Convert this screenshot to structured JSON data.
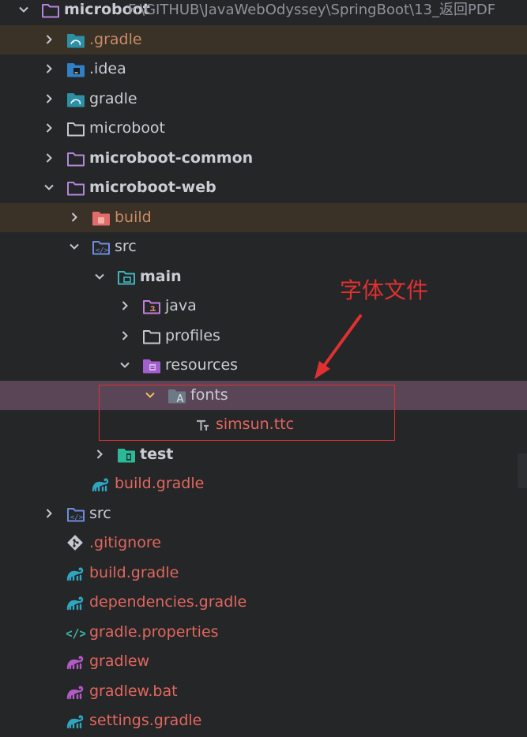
{
  "root": {
    "name": "microboot",
    "path": "F:\\GITHUB\\JavaWebOdyssey\\SpringBoot\\13_返回PDF"
  },
  "tree": [
    {
      "label": "microboot",
      "icon": "module-folder-icon",
      "depth": 0,
      "chevron": "down",
      "style": "bold",
      "row": "normal"
    },
    {
      "label": ".gradle",
      "icon": "gradle-folder-icon",
      "depth": 1,
      "chevron": "right",
      "style": "brown",
      "row": "ignored"
    },
    {
      "label": ".idea",
      "icon": "idea-folder-icon",
      "depth": 1,
      "chevron": "right",
      "style": "normal",
      "row": "normal"
    },
    {
      "label": "gradle",
      "icon": "gradle-folder-icon",
      "depth": 1,
      "chevron": "right",
      "style": "normal",
      "row": "normal"
    },
    {
      "label": "microboot",
      "icon": "folder-icon",
      "depth": 1,
      "chevron": "right",
      "style": "normal",
      "row": "normal"
    },
    {
      "label": "microboot-common",
      "icon": "module-folder-icon",
      "depth": 1,
      "chevron": "right",
      "style": "bold",
      "row": "normal"
    },
    {
      "label": "microboot-web",
      "icon": "module-folder-icon",
      "depth": 1,
      "chevron": "down",
      "style": "bold",
      "row": "normal"
    },
    {
      "label": "build",
      "icon": "build-folder-icon",
      "depth": 2,
      "chevron": "right",
      "style": "brown",
      "row": "ignored"
    },
    {
      "label": "src",
      "icon": "source-folder-icon",
      "depth": 2,
      "chevron": "down",
      "style": "normal",
      "row": "normal"
    },
    {
      "label": "main",
      "icon": "main-folder-icon",
      "depth": 3,
      "chevron": "down",
      "style": "bold",
      "row": "normal"
    },
    {
      "label": "java",
      "icon": "java-folder-icon",
      "depth": 4,
      "chevron": "right",
      "style": "normal",
      "row": "normal"
    },
    {
      "label": "profiles",
      "icon": "folder-icon",
      "depth": 4,
      "chevron": "right",
      "style": "normal",
      "row": "normal"
    },
    {
      "label": "resources",
      "icon": "resources-folder-icon",
      "depth": 4,
      "chevron": "down",
      "style": "normal",
      "row": "normal"
    },
    {
      "label": "fonts",
      "icon": "fonts-folder-icon",
      "depth": 5,
      "chevron": "down",
      "style": "normal",
      "row": "selected"
    },
    {
      "label": "simsun.ttc",
      "icon": "font-file-icon",
      "depth": 6,
      "chevron": "none",
      "style": "red",
      "row": "normal"
    },
    {
      "label": "test",
      "icon": "test-folder-icon",
      "depth": 3,
      "chevron": "right",
      "style": "bold",
      "row": "normal"
    },
    {
      "label": "build.gradle",
      "icon": "gradle-file-icon",
      "depth": 2,
      "chevron": "none",
      "style": "red",
      "row": "normal"
    },
    {
      "label": "src",
      "icon": "source-folder-icon",
      "depth": 1,
      "chevron": "right",
      "style": "normal",
      "row": "normal"
    },
    {
      "label": ".gitignore",
      "icon": "git-file-icon",
      "depth": 1,
      "chevron": "none",
      "style": "red",
      "row": "normal"
    },
    {
      "label": "build.gradle",
      "icon": "gradle-file-icon",
      "depth": 1,
      "chevron": "none",
      "style": "red",
      "row": "normal"
    },
    {
      "label": "dependencies.gradle",
      "icon": "gradle-file-icon",
      "depth": 1,
      "chevron": "none",
      "style": "red",
      "row": "normal"
    },
    {
      "label": "gradle.properties",
      "icon": "properties-file-icon",
      "depth": 1,
      "chevron": "none",
      "style": "red",
      "row": "normal"
    },
    {
      "label": "gradlew",
      "icon": "gradlew-file-icon",
      "depth": 1,
      "chevron": "none",
      "style": "red",
      "row": "normal"
    },
    {
      "label": "gradlew.bat",
      "icon": "gradlew-file-icon",
      "depth": 1,
      "chevron": "none",
      "style": "red",
      "row": "normal"
    },
    {
      "label": "settings.gradle",
      "icon": "gradle-file-icon",
      "depth": 1,
      "chevron": "none",
      "style": "red",
      "row": "normal"
    }
  ],
  "annotation": {
    "text": "字体文件",
    "color": "#e03131"
  },
  "colors": {
    "background": "#252628",
    "text": "#c9ccd2",
    "modified_red": "#e2665e",
    "ignored_brown": "#c98b67",
    "selected_row": "#5a4556",
    "ignored_row": "#3a3226"
  }
}
